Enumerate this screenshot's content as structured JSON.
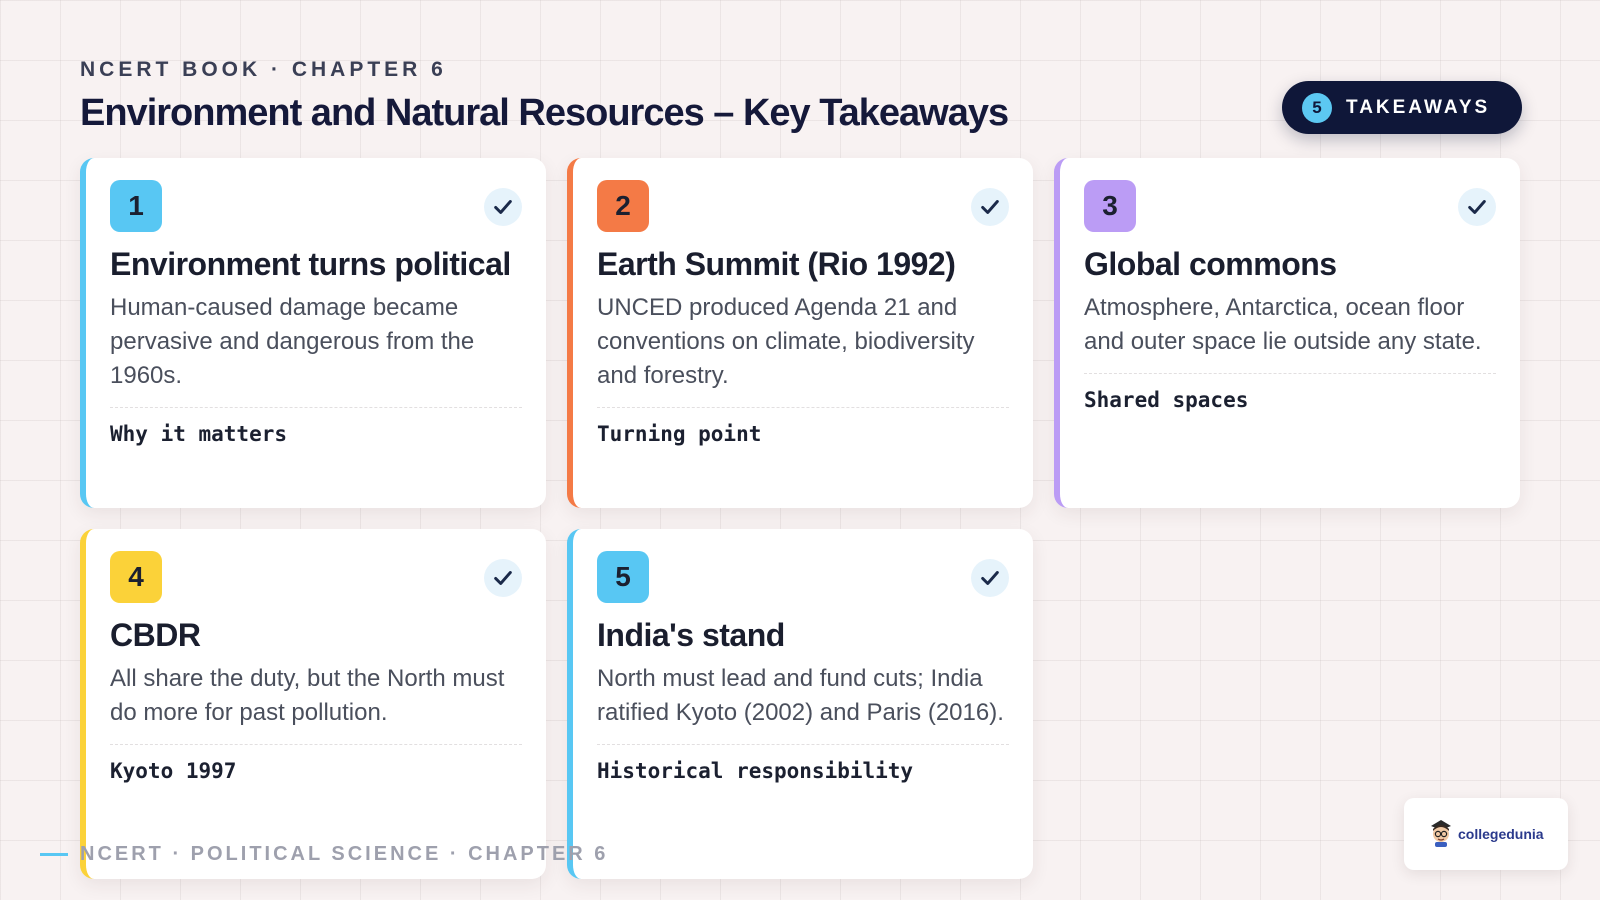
{
  "header": {
    "eyebrow": "NCERT BOOK · CHAPTER 6",
    "title": "Environment and Natural Resources – Key Takeaways"
  },
  "badge": {
    "count": "5",
    "label": "TAKEAWAYS"
  },
  "cards": [
    {
      "number": "1",
      "title": "Environment turns political",
      "body": "Human-caused damage became pervasive and dangerous from the 1960s.",
      "tag": "Why it matters",
      "color": "#58c7f3"
    },
    {
      "number": "2",
      "title": "Earth Summit (Rio 1992)",
      "body": "UNCED produced Agenda 21 and conventions on climate, biodiversity and forestry.",
      "tag": "Turning point",
      "color": "#f47a46"
    },
    {
      "number": "3",
      "title": "Global commons",
      "body": "Atmosphere, Antarctica, ocean floor and outer space lie outside any state.",
      "tag": "Shared spaces",
      "color": "#bb9cf5"
    },
    {
      "number": "4",
      "title": "CBDR",
      "body": "All share the duty, but the North must do more for past pollution.",
      "tag": "Kyoto 1997",
      "color": "#fbd239"
    },
    {
      "number": "5",
      "title": "India's stand",
      "body": "North must lead and fund cuts; India ratified Kyoto (2002) and Paris (2016).",
      "tag": "Historical responsibility",
      "color": "#58c7f3"
    }
  ],
  "footer": {
    "text": "NCERT · POLITICAL SCIENCE · CHAPTER 6"
  },
  "logo": {
    "text": "collegedunia"
  },
  "colors": {
    "badge_bg": "#0f1739",
    "background": "#f8f2f2",
    "check": "#1b2a4a"
  }
}
